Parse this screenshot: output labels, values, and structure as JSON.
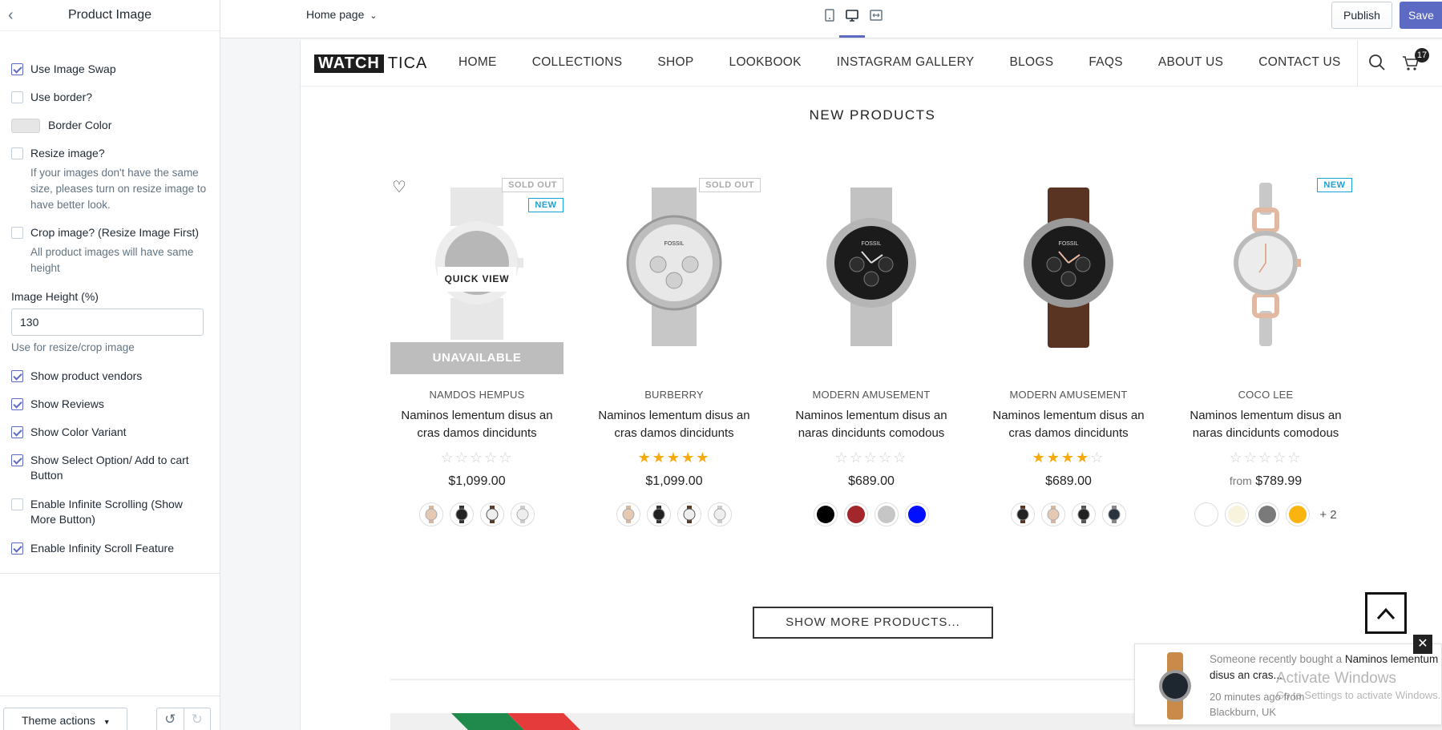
{
  "sidebar": {
    "title": "Product Image",
    "options": [
      {
        "label": "Use Image Swap",
        "checked": true
      },
      {
        "label": "Use border?",
        "checked": false
      },
      {
        "label": "Resize image?",
        "checked": false
      },
      {
        "label": "Crop image? (Resize Image First)",
        "checked": false
      },
      {
        "label": "Show product vendors",
        "checked": true
      },
      {
        "label": "Show Reviews",
        "checked": true
      },
      {
        "label": "Show Color Variant",
        "checked": true
      },
      {
        "label": "Show Select Option/ Add to cart Button",
        "checked": true
      },
      {
        "label": "Enable Infinite Scrolling (Show More Button)",
        "checked": false
      },
      {
        "label": "Enable Infinity Scroll Feature",
        "checked": true
      }
    ],
    "border_color_label": "Border Color",
    "resize_help": "If your images don't have the same size, pleases turn on resize image to have better look.",
    "crop_help": "All product images will have same height",
    "image_height_label": "Image Height (%)",
    "image_height_value": "130",
    "image_height_help": "Use for resize/crop image",
    "theme_actions": "Theme actions"
  },
  "topbar": {
    "page_selector": "Home page",
    "publish": "Publish",
    "save": "Save"
  },
  "store": {
    "logo_left": "WATCH",
    "logo_right": "TICA",
    "menu": [
      "HOME",
      "COLLECTIONS",
      "SHOP",
      "LOOKBOOK",
      "INSTAGRAM GALLERY",
      "BLOGS",
      "FAQS",
      "ABOUT US",
      "CONTACT US"
    ],
    "cart_count": "17",
    "section_title": "NEW PRODUCTS",
    "show_more": "SHOW MORE PRODUCTS...",
    "products": [
      {
        "vendor": "NAMDOS HEMPUS",
        "name": "Naminos lementum disus an cras damos dincidunts",
        "rating": 0,
        "price": "$1,099.00",
        "sold_out": "SOLD OUT",
        "new": "NEW",
        "unavailable": "UNAVAILABLE",
        "quick_view": "QUICK VIEW"
      },
      {
        "vendor": "BURBERRY",
        "name": "Naminos lementum disus an cras damos dincidunts",
        "rating": 5,
        "price": "$1,099.00",
        "sold_out": "SOLD OUT"
      },
      {
        "vendor": "MODERN AMUSEMENT",
        "name": "Naminos lementum disus an naras dincidunts comodous",
        "rating": 0,
        "price": "$689.00"
      },
      {
        "vendor": "MODERN AMUSEMENT",
        "name": "Naminos lementum disus an cras damos dincidunts",
        "rating": 4,
        "price": "$689.00"
      },
      {
        "vendor": "COCO LEE",
        "name": "Naminos lementum disus an naras dincidunts comodous",
        "rating": 0,
        "price_prefix": "from",
        "price": "$789.99",
        "new": "NEW",
        "more_variants": "+ 2"
      }
    ],
    "variant_colors": {
      "p3": [
        "#000000",
        "#a3262a",
        "#c6c6c6",
        "#0010ff"
      ],
      "p5": [
        "#ffffff",
        "#f7f3dc",
        "#7a7a7a",
        "#fbb40f"
      ]
    }
  },
  "toast": {
    "text_prefix": "Someone recently bought a",
    "product": "Naminos lementum disus an cras...",
    "time": "20 minutes ago from",
    "location": "Blackburn, UK"
  },
  "watermark": {
    "title": "Activate Windows",
    "subtitle": "Go to Settings to activate Windows."
  },
  "colors": {
    "accent": "#5c6ac4",
    "new_badge": "#19a2d8",
    "star": "#f7a90d"
  }
}
